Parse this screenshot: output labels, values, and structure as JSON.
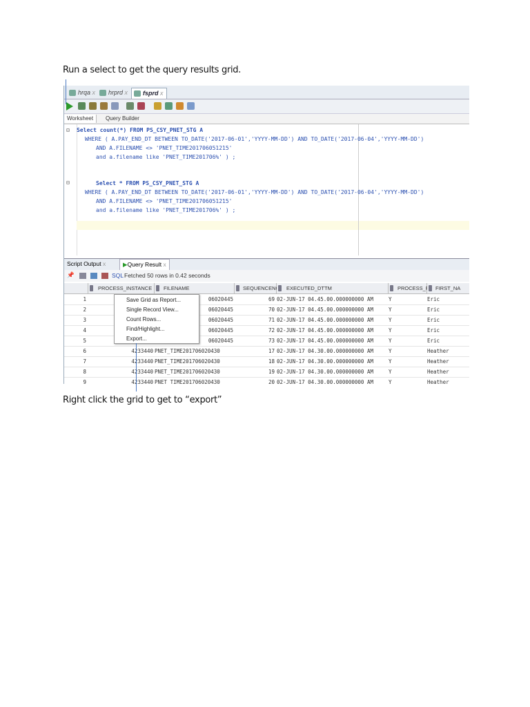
{
  "captions": {
    "top": "Run a select to get the query results grid.",
    "bottom": "Right click the grid to get to “export”"
  },
  "file_tabs": [
    {
      "label": "hrqa",
      "active": false
    },
    {
      "label": "hrprd",
      "active": false
    },
    {
      "label": "fsprd",
      "active": true
    }
  ],
  "close_glyph": "x",
  "worksheet_tabs": [
    "Worksheet",
    "Query Builder"
  ],
  "editor": {
    "q1": [
      "Select count(*) FROM PS_CSY_PNET_STG A",
      "WHERE ( A.PAY_END_DT BETWEEN TO_DATE('2017-06-01','YYYY-MM-DD') AND TO_DATE('2017-06-04','YYYY-MM-DD')",
      "AND A.FILENAME <> 'PNET_TIME201706051215'",
      "and a.filename like 'PNET_TIME201706%' ) ;"
    ],
    "q2": [
      "Select * FROM PS_CSY_PNET_STG A",
      "WHERE ( A.PAY_END_DT BETWEEN TO_DATE('2017-06-01','YYYY-MM-DD') AND TO_DATE('2017-06-04','YYYY-MM-DD')",
      "AND A.FILENAME <> 'PNET_TIME201706051215'",
      "and a.filename like 'PNET_TIME201706%' ) ;"
    ]
  },
  "result_tabs": [
    "Script Output",
    "Query Result"
  ],
  "result_bar": {
    "sql": "SQL",
    "status": "Fetched 50 rows in 0.42 seconds"
  },
  "columns": [
    "PROCESS_INSTANCE",
    "FILENAME",
    "SEQUENCENO",
    "EXECUTED_DTTM",
    "PROCESS_FLG",
    "FIRST_NA"
  ],
  "rows": [
    [
      "1",
      "",
      "06020445",
      "69",
      "02-JUN-17 04.45.00.000000000 AM",
      "Y",
      "Eric"
    ],
    [
      "2",
      "",
      "06020445",
      "70",
      "02-JUN-17 04.45.00.000000000 AM",
      "Y",
      "Eric"
    ],
    [
      "3",
      "",
      "06020445",
      "71",
      "02-JUN-17 04.45.00.000000000 AM",
      "Y",
      "Eric"
    ],
    [
      "4",
      "",
      "06020445",
      "72",
      "02-JUN-17 04.45.00.000000000 AM",
      "Y",
      "Eric"
    ],
    [
      "5",
      "",
      "06020445",
      "73",
      "02-JUN-17 04.45.00.000000000 AM",
      "Y",
      "Eric"
    ],
    [
      "6",
      "4233440",
      "PNET_TIME201706020430",
      "17",
      "02-JUN-17 04.30.00.000000000 AM",
      "Y",
      "Heather"
    ],
    [
      "7",
      "4233440",
      "PNET_TIME201706020430",
      "18",
      "02-JUN-17 04.30.00.000000000 AM",
      "Y",
      "Heather"
    ],
    [
      "8",
      "4233440",
      "PNET_TIME201706020430",
      "19",
      "02-JUN-17 04.30.00.000000000 AM",
      "Y",
      "Heather"
    ],
    [
      "9",
      "4233440",
      "PNET_TIME201706020430",
      "20",
      "02-JUN-17 04.30.00.000000000 AM",
      "Y",
      "Heather"
    ]
  ],
  "context_menu": [
    "Save Grid as Report...",
    "Single Record View...",
    "Count Rows...",
    "Find/Highlight...",
    "Export..."
  ],
  "colors": {
    "accent": "#4a78c0",
    "selection": "#3d7dd8",
    "current_line": "#fdfbe3"
  }
}
